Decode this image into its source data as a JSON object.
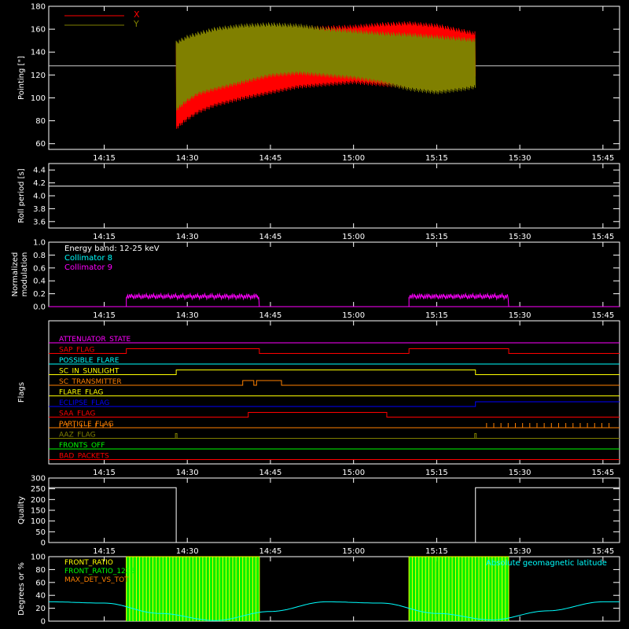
{
  "colors": {
    "background": "#000000",
    "axis": "#ffffff",
    "pointing_x": "#ff0000",
    "pointing_y": "#808000",
    "cyan": "#00ffff",
    "magenta": "#ff00ff",
    "green": "#00ff00",
    "yellow": "#ffff00",
    "orange": "#ff8000"
  },
  "time_ticks": [
    "14:15",
    "14:30",
    "14:45",
    "15:00",
    "15:15",
    "15:30",
    "15:45"
  ],
  "time_range_min": [
    845,
    948
  ],
  "chart_data": [
    {
      "id": "pointing",
      "type": "line",
      "title": "",
      "xlabel": "",
      "ylabel": "Pointing [\"]",
      "ylim": [
        55,
        180
      ],
      "yticks": [
        "60",
        "80",
        "100",
        "120",
        "140",
        "160",
        "180"
      ],
      "legend": [
        "X",
        "Y"
      ],
      "legend_position": "top-left",
      "reference_line": 128,
      "data_span_min": [
        868,
        922
      ],
      "series": [
        {
          "name": "X",
          "color": "#ff0000",
          "x_min": [
            868,
            870,
            872,
            875,
            880,
            885,
            890,
            895,
            900,
            905,
            910,
            915,
            920,
            922
          ],
          "high": [
            148,
            152,
            155,
            158,
            161,
            162,
            163,
            163,
            164,
            166,
            167,
            165,
            160,
            158
          ],
          "low": [
            72,
            80,
            86,
            92,
            98,
            103,
            108,
            110,
            112,
            110,
            108,
            112,
            116,
            118
          ]
        },
        {
          "name": "Y",
          "color": "#808000",
          "x_min": [
            868,
            870,
            872,
            875,
            880,
            885,
            890,
            895,
            900,
            905,
            910,
            915,
            920,
            922
          ],
          "high": [
            150,
            155,
            158,
            162,
            165,
            166,
            165,
            162,
            160,
            158,
            157,
            155,
            153,
            152
          ],
          "low": [
            88,
            96,
            102,
            106,
            112,
            118,
            120,
            118,
            116,
            112,
            106,
            103,
            106,
            108
          ]
        }
      ]
    },
    {
      "id": "roll",
      "type": "line",
      "title": "",
      "xlabel": "",
      "ylabel": "Roll period [s]",
      "ylim": [
        3.5,
        4.5
      ],
      "yticks": [
        "3.6",
        "3.8",
        "4.0",
        "4.2",
        "4.4"
      ],
      "series": [
        {
          "name": "",
          "x_min": [
            845,
            948
          ],
          "values": [
            4.15,
            4.15
          ]
        }
      ]
    },
    {
      "id": "modulation",
      "type": "line",
      "title": "",
      "xlabel": "",
      "ylabel": "Normalized modulation",
      "ylim": [
        0,
        1.0
      ],
      "yticks": [
        "0.0",
        "0.2",
        "0.4",
        "0.6",
        "0.8",
        "1.0"
      ],
      "annotations": [
        {
          "text": "Energy band: 12-25 keV",
          "color": "#ffffff"
        },
        {
          "text": "Collimator 8",
          "color": "#00ffff"
        },
        {
          "text": "Collimator 9",
          "color": "#ff00ff"
        }
      ],
      "series": [
        {
          "name": "Collimator 9",
          "color": "#ff00ff",
          "baseline": 0.0,
          "segments": [
            {
              "x_min": [
                859,
                883
              ],
              "value": 0.15
            },
            {
              "x_min": [
                910,
                928
              ],
              "value": 0.15
            }
          ]
        }
      ]
    },
    {
      "id": "flags",
      "type": "line",
      "title": "",
      "xlabel": "",
      "ylabel": "Flags",
      "flags": [
        {
          "name": "ATTENUATOR_STATE",
          "color": "#ff00ff",
          "transitions": []
        },
        {
          "name": "SAP_FLAG",
          "color": "#ff0000",
          "transitions": [
            [
              859,
              1
            ],
            [
              883,
              0
            ],
            [
              910,
              1
            ],
            [
              928,
              0
            ]
          ]
        },
        {
          "name": "POSSIBLE_FLARE",
          "color": "#00ffff",
          "transitions": []
        },
        {
          "name": "SC_IN_SUNLIGHT",
          "color": "#ffff00",
          "transitions": [
            [
              868,
              1
            ],
            [
              922,
              0
            ]
          ]
        },
        {
          "name": "SC_TRANSMITTER",
          "color": "#ff8000",
          "transitions": [
            [
              880,
              1
            ],
            [
              882,
              0
            ],
            [
              882.5,
              1
            ],
            [
              887,
              0
            ]
          ]
        },
        {
          "name": "FLARE_FLAG",
          "color": "#ffff00",
          "transitions": []
        },
        {
          "name": "ECLIPSE_FLAG",
          "color": "#0000ff",
          "transitions": [
            [
              868,
              0
            ],
            [
              922,
              1
            ]
          ]
        },
        {
          "name": "SAA_FLAG",
          "color": "#ff0000",
          "transitions": [
            [
              881,
              1
            ],
            [
              906,
              0
            ]
          ]
        },
        {
          "name": "PARTICLE_FLAG",
          "color": "#ff8000",
          "transitions": []
        },
        {
          "name": "AAZ_FLAG",
          "color": "#808000",
          "transitions": []
        },
        {
          "name": "FRONTS_OFF",
          "color": "#00ff00",
          "transitions": []
        },
        {
          "name": "BAD_PACKETS",
          "color": "#ff0000",
          "transitions": []
        }
      ]
    },
    {
      "id": "quality",
      "type": "line",
      "title": "",
      "xlabel": "",
      "ylabel": "Quality",
      "ylim": [
        0,
        300
      ],
      "yticks": [
        "0",
        "50",
        "100",
        "150",
        "200",
        "250",
        "300"
      ],
      "series": [
        {
          "name": "",
          "x_min": [
            845,
            868,
            868,
            922,
            922,
            948
          ],
          "values": [
            255,
            255,
            0,
            0,
            255,
            255
          ]
        }
      ]
    },
    {
      "id": "ratios",
      "type": "line",
      "title": "",
      "xlabel": "",
      "ylabel": "Degrees or %",
      "ylim": [
        0,
        100
      ],
      "yticks": [
        "0",
        "20",
        "40",
        "60",
        "80",
        "100"
      ],
      "legend": [
        "FRONT_RATIO",
        "FRONT_RATIO_1225",
        "MAX_DET_VS_TOT"
      ],
      "annotation": "Absolute geomagnetic latitude",
      "series": [
        {
          "name": "FRONT_RATIO",
          "color": "#ffff00",
          "segments": [
            [
              859,
              883
            ],
            [
              910,
              928
            ]
          ]
        },
        {
          "name": "FRONT_RATIO_1225",
          "color": "#00ff00",
          "segments": [
            [
              859,
              883
            ],
            [
              910,
              928
            ]
          ]
        },
        {
          "name": "MAX_DET_VS_TOT",
          "color": "#ff8000",
          "segments": []
        },
        {
          "name": "Absolute geomagnetic latitude",
          "color": "#00ffff",
          "x_min": [
            845,
            855,
            865,
            875,
            885,
            895,
            905,
            915,
            925,
            935,
            945,
            948
          ],
          "values": [
            30,
            28,
            12,
            1,
            15,
            30,
            28,
            12,
            2,
            16,
            30,
            30
          ]
        }
      ]
    }
  ]
}
